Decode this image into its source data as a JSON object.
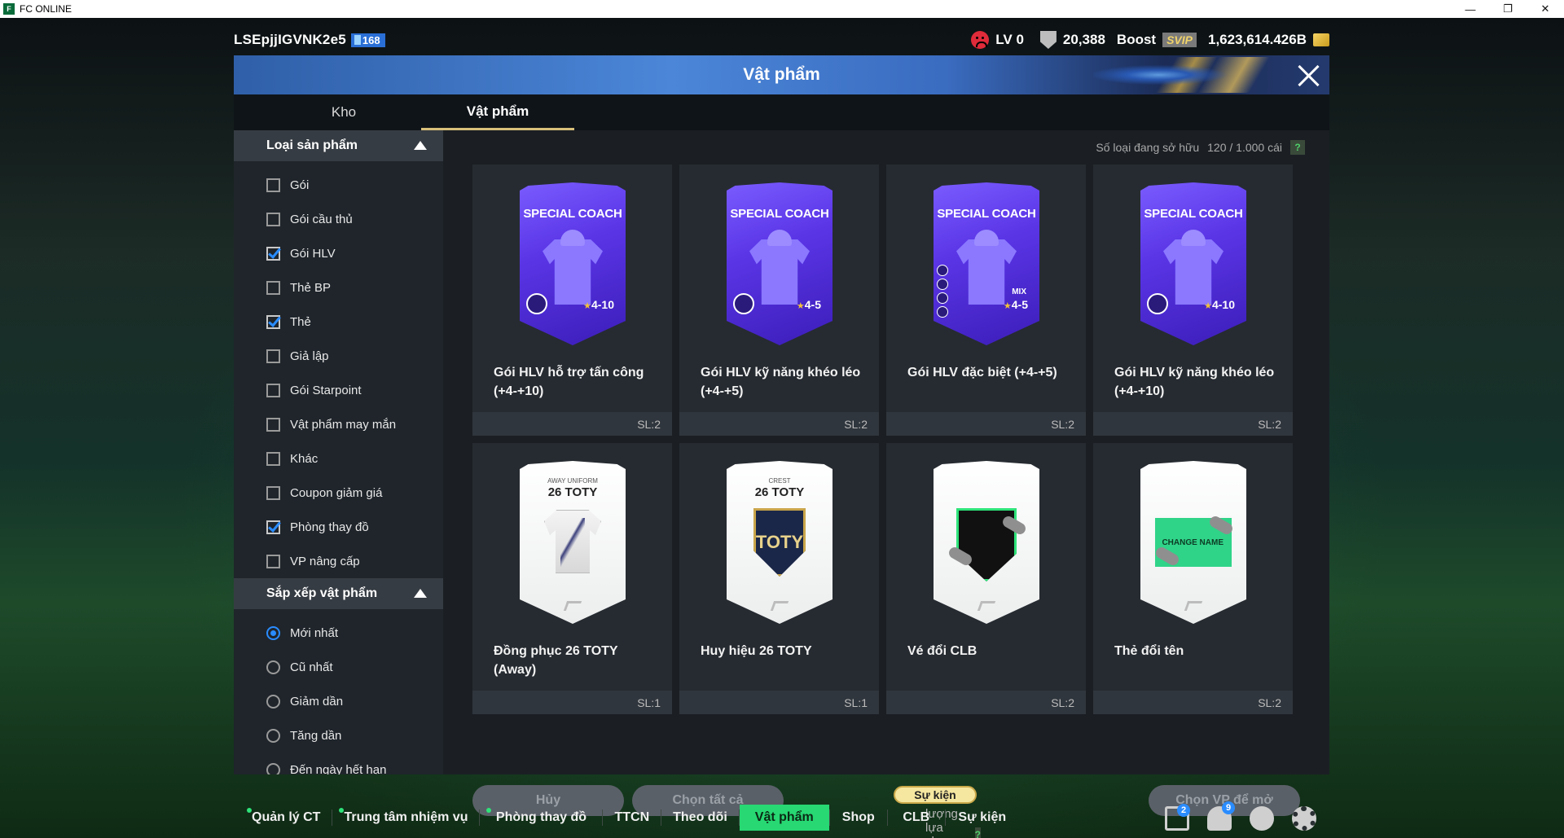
{
  "window": {
    "title": "FC ONLINE",
    "controls": [
      "—",
      "❐",
      "✕"
    ]
  },
  "status": {
    "username": "LSEpjjIGVNK2e5",
    "level": "168",
    "lv_label": "LV 0",
    "points": "20,388",
    "boost_label": "Boost",
    "svip_label": "SVIP",
    "bp_balance": "1,623,614.426B"
  },
  "modal": {
    "title": "Vật phẩm",
    "tabs": [
      {
        "label": "Kho",
        "active": false
      },
      {
        "label": "Vật phẩm",
        "active": true
      }
    ]
  },
  "sidebar": {
    "filter_title": "Loại sản phẩm",
    "filters": [
      {
        "label": "Gói",
        "checked": false
      },
      {
        "label": "Gói cầu thủ",
        "checked": false
      },
      {
        "label": "Gói HLV",
        "checked": true
      },
      {
        "label": "Thẻ BP",
        "checked": false
      },
      {
        "label": "Thẻ",
        "checked": true
      },
      {
        "label": "Giả lập",
        "checked": false
      },
      {
        "label": "Gói Starpoint",
        "checked": false
      },
      {
        "label": "Vật phẩm may mắn",
        "checked": false
      },
      {
        "label": "Khác",
        "checked": false
      },
      {
        "label": "Coupon giảm giá",
        "checked": false
      },
      {
        "label": "Phòng thay đồ",
        "checked": true
      },
      {
        "label": "VP nâng cấp",
        "checked": false
      }
    ],
    "sort_title": "Sắp xếp vật phẩm",
    "sorts": [
      {
        "label": "Mới nhất",
        "selected": true
      },
      {
        "label": "Cũ nhất",
        "selected": false
      },
      {
        "label": "Giảm dần",
        "selected": false
      },
      {
        "label": "Tăng dần",
        "selected": false
      },
      {
        "label": "Đến ngày hết hạn",
        "selected": false
      }
    ]
  },
  "content": {
    "owned_label": "Số loại đang sở hữu",
    "owned_value": "120 / 1.000 cái",
    "help": "?",
    "items": [
      {
        "name": "Gói HLV hỗ trợ tấn công (+4-+10)",
        "qty": "SL:2",
        "card": "coach",
        "card_title": "SPECIAL COACH",
        "range_from": "4",
        "range_to": "10",
        "mix": ""
      },
      {
        "name": "Gói HLV kỹ năng khéo léo (+4-+5)",
        "qty": "SL:2",
        "card": "coach",
        "card_title": "SPECIAL COACH",
        "range_from": "4",
        "range_to": "5",
        "mix": ""
      },
      {
        "name": "Gói HLV đặc biệt (+4-+5)",
        "qty": "SL:2",
        "card": "coach",
        "card_title": "SPECIAL COACH",
        "range_from": "4",
        "range_to": "5",
        "mix": "MIX"
      },
      {
        "name": "Gói HLV kỹ năng khéo léo (+4-+10)",
        "qty": "SL:2",
        "card": "coach",
        "card_title": "SPECIAL COACH",
        "range_from": "4",
        "range_to": "10",
        "mix": ""
      },
      {
        "name": "Đồng phục 26 TOTY (Away)",
        "qty": "SL:1",
        "card": "uniform",
        "card_kicker": "AWAY UNIFORM",
        "card_title": "26 TOTY"
      },
      {
        "name": "Huy hiệu 26 TOTY",
        "qty": "SL:1",
        "card": "crest",
        "card_kicker": "CREST",
        "card_title": "26 TOTY",
        "crest_text": "TOTY"
      },
      {
        "name": "Vé đổi CLB",
        "qty": "SL:2",
        "card": "club",
        "card_title": ""
      },
      {
        "name": "Thẻ đổi tên",
        "qty": "SL:2",
        "card": "rename",
        "ticket_text": "CHANGE NAME"
      }
    ],
    "cancel_label": "Hủy",
    "select_all_label": "Chọn tất cả",
    "selection_label": "Số lượng lựa chọn : 0 / 150 món",
    "open_label": "Chọn VP để mở"
  },
  "bottom_nav": {
    "event_pill": "Sự kiện",
    "items": [
      {
        "label": "Quản lý CT",
        "dot": true,
        "active": false
      },
      {
        "label": "Trung tâm nhiệm vụ",
        "dot": true,
        "active": false
      },
      {
        "label": "Phòng thay đồ",
        "dot": true,
        "active": false
      },
      {
        "label": "TTCN",
        "dot": false,
        "active": false
      },
      {
        "label": "Theo dõi",
        "dot": false,
        "active": false
      },
      {
        "label": "Vật phẩm",
        "dot": false,
        "active": true
      },
      {
        "label": "Shop",
        "dot": false,
        "active": false
      },
      {
        "label": "CLB",
        "dot": false,
        "active": false
      },
      {
        "label": "Sự kiện",
        "dot": false,
        "active": false
      }
    ],
    "mail_badge": "2",
    "bell_badge": "9"
  },
  "colors": {
    "accent_green": "#27d873",
    "checkbox_blue": "#2a8cff",
    "coach_purple": "#5a35e6"
  }
}
